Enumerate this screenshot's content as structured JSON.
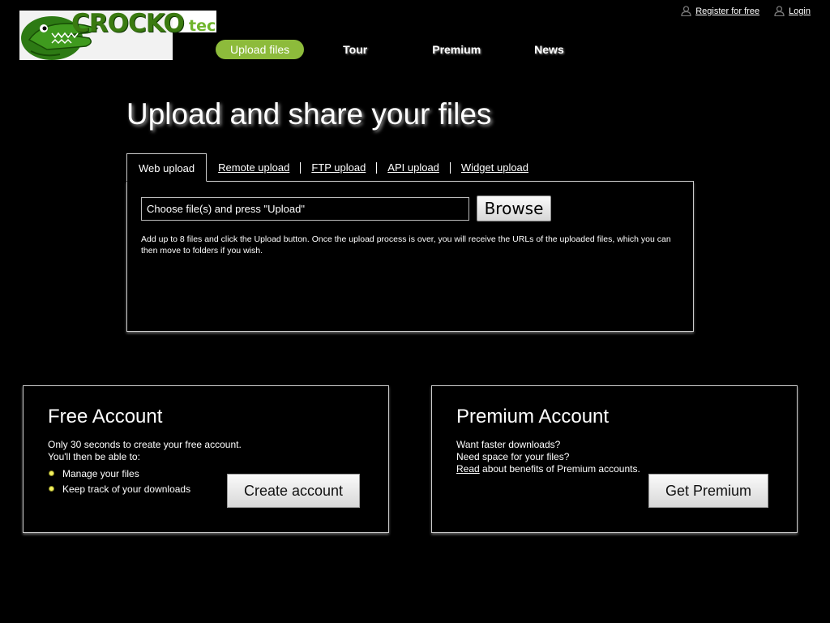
{
  "brand": {
    "name": "CROCKO",
    "suffix": "tec"
  },
  "top_links": {
    "register": "Register for free",
    "login": "Login"
  },
  "nav": {
    "upload": "Upload files",
    "tour": "Tour",
    "premium": "Premium",
    "news": "News"
  },
  "headline": "Upload and share your files",
  "tabs": {
    "web": "Web upload",
    "remote": "Remote upload",
    "ftp": "FTP upload",
    "api": "API upload",
    "widget": "Widget upload"
  },
  "upload": {
    "file_field": "Choose file(s) and press \"Upload\"",
    "browse_label": "Browse",
    "note": "Add up to 8 files and click the Upload button. Once the upload process is over, you will receive the URLs of the uploaded files, which you can then move to folders if you wish."
  },
  "free_account": {
    "title": "Free Account",
    "line1": "Only 30 seconds to create your free account.",
    "line2": "You'll then be able to:",
    "items": [
      "Manage your files",
      "Keep track of your downloads"
    ],
    "button": "Create account"
  },
  "premium_account": {
    "title": "Premium Account",
    "line1": "Want faster downloads?",
    "line2": "Need space for your files?",
    "read_link": "Read",
    "line3_rest": " about benefits of Premium accounts.",
    "button": "Get Premium"
  },
  "colors": {
    "background": "#000000",
    "accent_green": "#8dbb3b",
    "logo_green": "#3a7a10",
    "bullet_yellow": "#f4f160"
  },
  "icons": [
    "crocodile-logo",
    "user-icon"
  ]
}
